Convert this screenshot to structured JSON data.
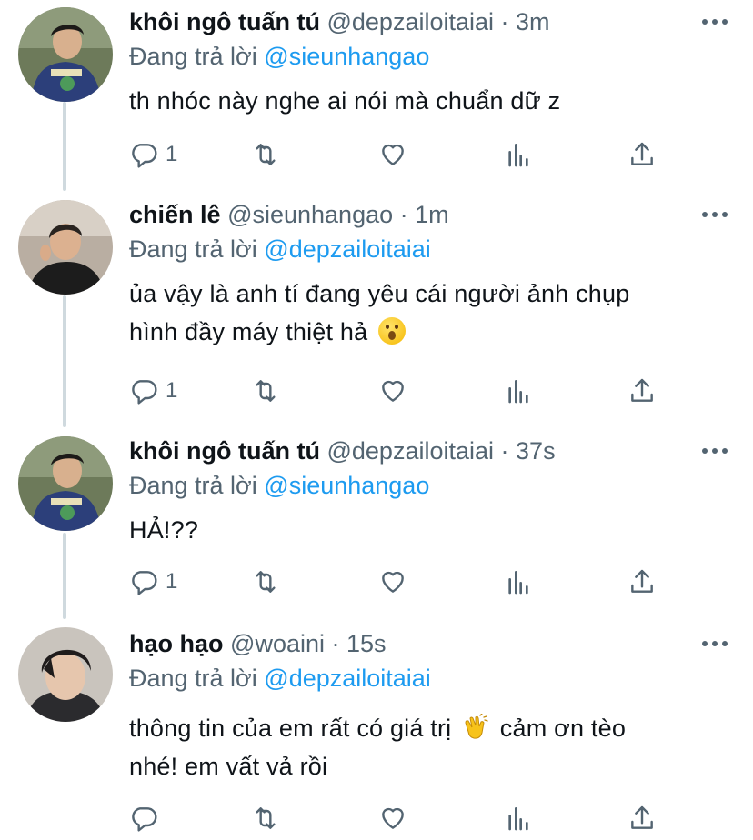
{
  "tweets": [
    {
      "name": "khôi ngô tuấn tú",
      "handle": "@depzailoitaiai",
      "sep": "·",
      "time": "3m",
      "replying_prefix": "Đang trả lời",
      "replying_to": "@sieunhangao",
      "text_lines": [
        "th nhóc này nghe ai nói mà chuẩn dữ z"
      ],
      "reply_count": "1"
    },
    {
      "name": "chiến lê",
      "handle": "@sieunhangao",
      "sep": "·",
      "time": "1m",
      "replying_prefix": "Đang trả lời",
      "replying_to": "@depzailoitaiai",
      "text_lines": [
        "ủa vậy là anh tí đang yêu cái người ảnh chụp",
        "hình đầy máy thiệt hả"
      ],
      "emoji": "hushed-face",
      "reply_count": "1"
    },
    {
      "name": "khôi ngô tuấn tú",
      "handle": "@depzailoitaiai",
      "sep": "·",
      "time": "37s",
      "replying_prefix": "Đang trả lời",
      "replying_to": "@sieunhangao",
      "text_lines": [
        "HẢ!??"
      ],
      "reply_count": "1"
    },
    {
      "name": "hạo hạo",
      "handle": "@woaini",
      "sep": "·",
      "time": "15s",
      "replying_prefix": "Đang trả lời",
      "replying_to": "@depzailoitaiai",
      "text_lines_a": "thông tin của em rất có giá trị",
      "text_lines_b": "cảm ơn tèo",
      "text_line_2": "nhé! em vất vả rồi",
      "emoji": "clapping-hands",
      "reply_count": ""
    }
  ],
  "icons": {
    "reply": "reply-icon",
    "retweet": "retweet-icon",
    "like": "heart-icon",
    "analytics": "analytics-icon",
    "share": "share-icon",
    "more": "more-icon"
  },
  "colors": {
    "text": "#0f1419",
    "secondary": "#536471",
    "mention": "#1d9bf0",
    "thread_line": "#cfd9de"
  }
}
